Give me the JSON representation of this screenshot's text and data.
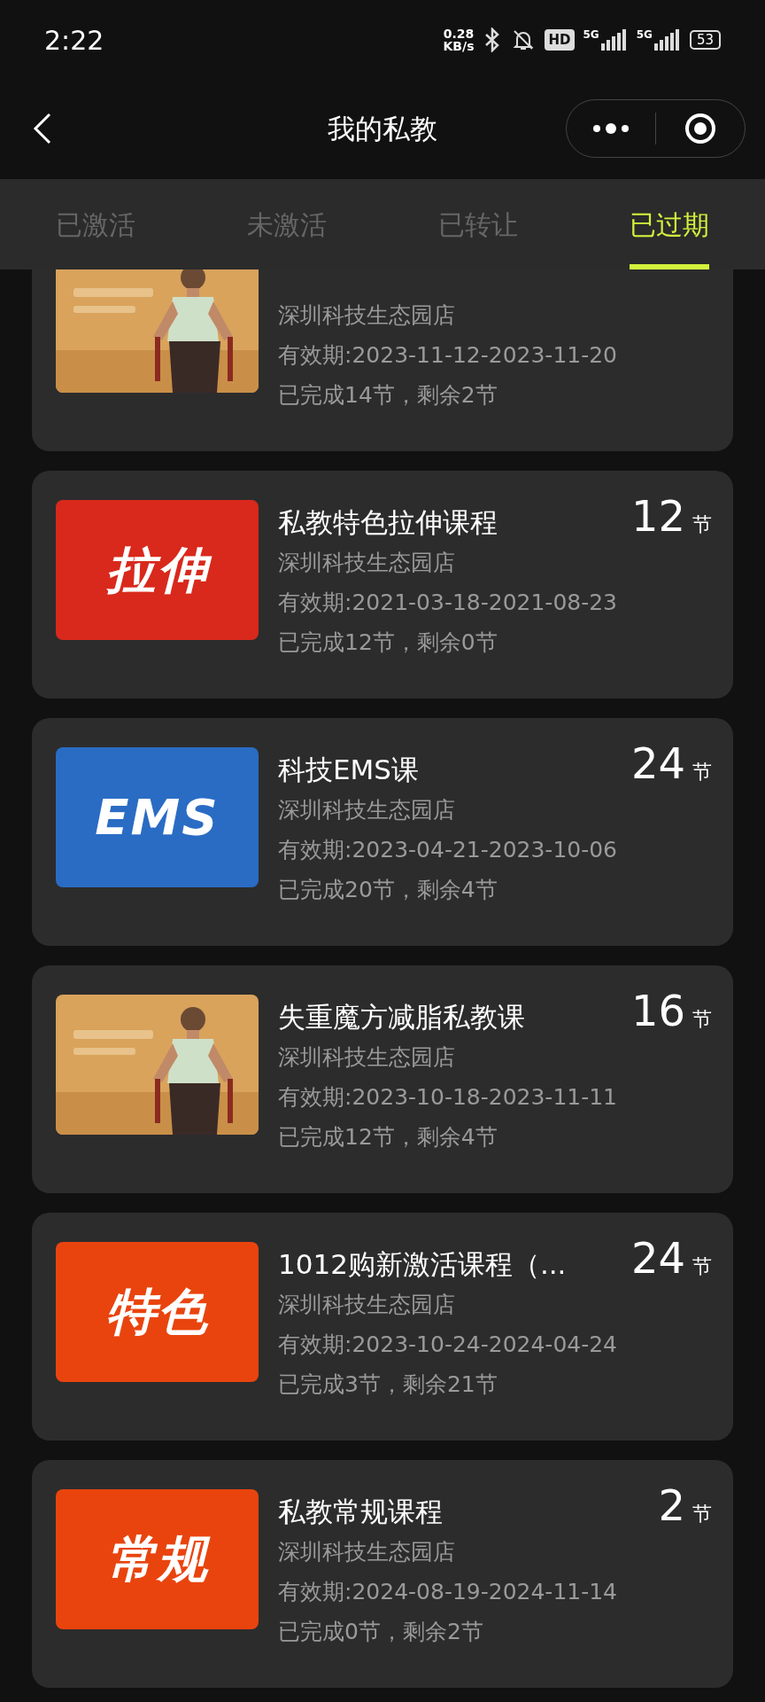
{
  "status_bar": {
    "time": "2:22",
    "speed_value": "0.28",
    "speed_unit": "KB/s",
    "hd": "HD",
    "networks": [
      "5G",
      "5G"
    ],
    "battery": "53"
  },
  "nav": {
    "title": "我的私教"
  },
  "tabs": [
    {
      "label": "已激活",
      "selected": false
    },
    {
      "label": "未激活",
      "selected": false
    },
    {
      "label": "已转让",
      "selected": false
    },
    {
      "label": "已过期",
      "selected": true
    }
  ],
  "courses": [
    {
      "store": "深圳科技生态园店",
      "validity": "有效期:2023-11-12-2023-11-20",
      "progress": "已完成14节，剩余2节"
    },
    {
      "thumb": {
        "kind": "banner",
        "text": "拉伸",
        "color": "#d8291c"
      },
      "title": "私教特色拉伸课程",
      "count": "12",
      "unit": "节",
      "store": "深圳科技生态园店",
      "validity": "有效期:2021-03-18-2021-08-23",
      "progress": "已完成12节，剩余0节"
    },
    {
      "thumb": {
        "kind": "banner",
        "text": "EMS",
        "color": "#2a6cc4"
      },
      "title": "科技EMS课",
      "count": "24",
      "unit": "节",
      "store": "深圳科技生态园店",
      "validity": "有效期:2023-04-21-2023-10-06",
      "progress": "已完成20节，剩余4节"
    },
    {
      "title": "失重魔方减脂私教课",
      "count": "16",
      "unit": "节",
      "store": "深圳科技生态园店",
      "validity": "有效期:2023-10-18-2023-11-11",
      "progress": "已完成12节，剩余4节"
    },
    {
      "thumb": {
        "kind": "banner",
        "text": "特色",
        "color": "#e9440e"
      },
      "title": "1012购新激活课程（...",
      "count": "24",
      "unit": "节",
      "store": "深圳科技生态园店",
      "validity": "有效期:2023-10-24-2024-04-24",
      "progress": "已完成3节，剩余21节"
    },
    {
      "thumb": {
        "kind": "banner",
        "text": "常规",
        "color": "#e9440e"
      },
      "title": "私教常规课程",
      "count": "2",
      "unit": "节",
      "store": "深圳科技生态园店",
      "validity": "有效期:2024-08-19-2024-11-14",
      "progress": "已完成0节，剩余2节"
    }
  ]
}
